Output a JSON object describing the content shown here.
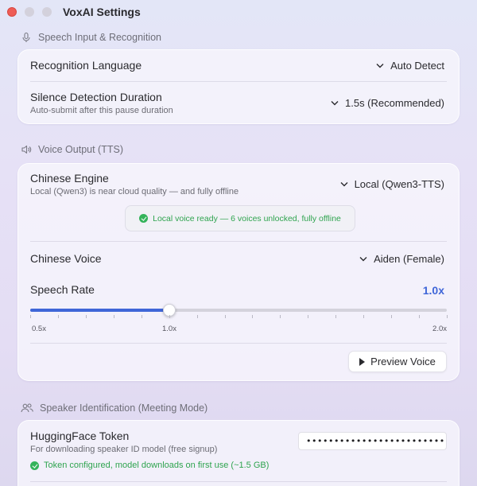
{
  "window": {
    "title": "VoxAI Settings"
  },
  "speech_input": {
    "header": "Speech Input & Recognition",
    "icon": "microphone-icon",
    "recognition_language": {
      "label": "Recognition Language",
      "value": "Auto Detect"
    },
    "silence_detection": {
      "label": "Silence Detection Duration",
      "sublabel": "Auto-submit after this pause duration",
      "value": "1.5s (Recommended)"
    }
  },
  "voice_output": {
    "header": "Voice Output (TTS)",
    "icon": "speaker-icon",
    "chinese_engine": {
      "label": "Chinese Engine",
      "sublabel": "Local (Qwen3) is near cloud quality — and fully offline",
      "value": "Local (Qwen3-TTS)"
    },
    "status": "Local voice ready — 6 voices unlocked, fully offline",
    "chinese_voice": {
      "label": "Chinese Voice",
      "value": "Aiden (Female)"
    },
    "speech_rate": {
      "label": "Speech Rate",
      "value_text": "1.0x",
      "min": 0.5,
      "max": 2.0,
      "value": 1.0,
      "min_label": "0.5x",
      "mid_label": "1.0x",
      "max_label": "2.0x"
    },
    "preview_button": "Preview Voice"
  },
  "speaker_id": {
    "header": "Speaker Identification (Meeting Mode)",
    "icon": "people-icon",
    "hf_token": {
      "label": "HuggingFace Token",
      "sublabel": "For downloading speaker ID model (free signup)",
      "value": "•••••••••••••••••••••••••••"
    },
    "status": "Token configured, model downloads on first use (~1.5 GB)"
  },
  "colors": {
    "accent": "#3f66d8",
    "success": "#34b35a",
    "close": "#ee5c56"
  }
}
